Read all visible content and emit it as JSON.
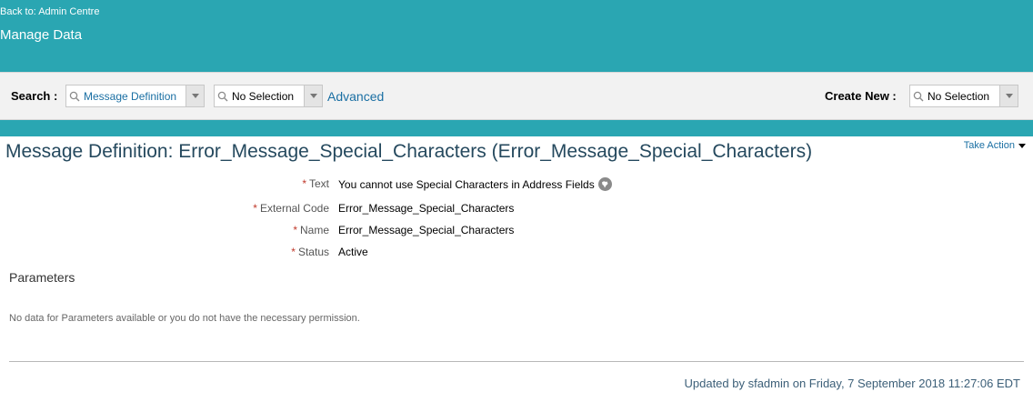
{
  "header": {
    "back_link": "Back to: Admin Centre",
    "page_title": "Manage Data"
  },
  "toolbar": {
    "search_label": "Search :",
    "search_object": "Message Definition",
    "search_value": "No Selection",
    "advanced_link": "Advanced",
    "create_new_label": "Create New :",
    "create_new_value": "No Selection"
  },
  "record": {
    "title": "Message Definition: Error_Message_Special_Characters (Error_Message_Special_Characters)",
    "take_action": "Take Action",
    "fields": [
      {
        "required_mark": "*",
        "label": "Text",
        "value": "You cannot use Special Characters in Address Fields",
        "icon": "globe-icon"
      },
      {
        "required_mark": "*",
        "label": "External Code",
        "value": "Error_Message_Special_Characters"
      },
      {
        "required_mark": "*",
        "label": "Name",
        "value": "Error_Message_Special_Characters"
      },
      {
        "required_mark": "*",
        "label": "Status",
        "value": "Active"
      }
    ]
  },
  "parameters": {
    "heading": "Parameters",
    "empty_message": "No data for Parameters available or you do not have the necessary permission."
  },
  "footer": {
    "updated_text": "Updated by sfadmin on Friday, 7 September 2018 11:27:06 EDT"
  },
  "colors": {
    "header_teal": "#2aa6b2",
    "toolbar_bg": "#f2f2f2",
    "link_blue": "#1a6fa3",
    "title_navy": "#25495e",
    "required_red": "#c0392b"
  }
}
